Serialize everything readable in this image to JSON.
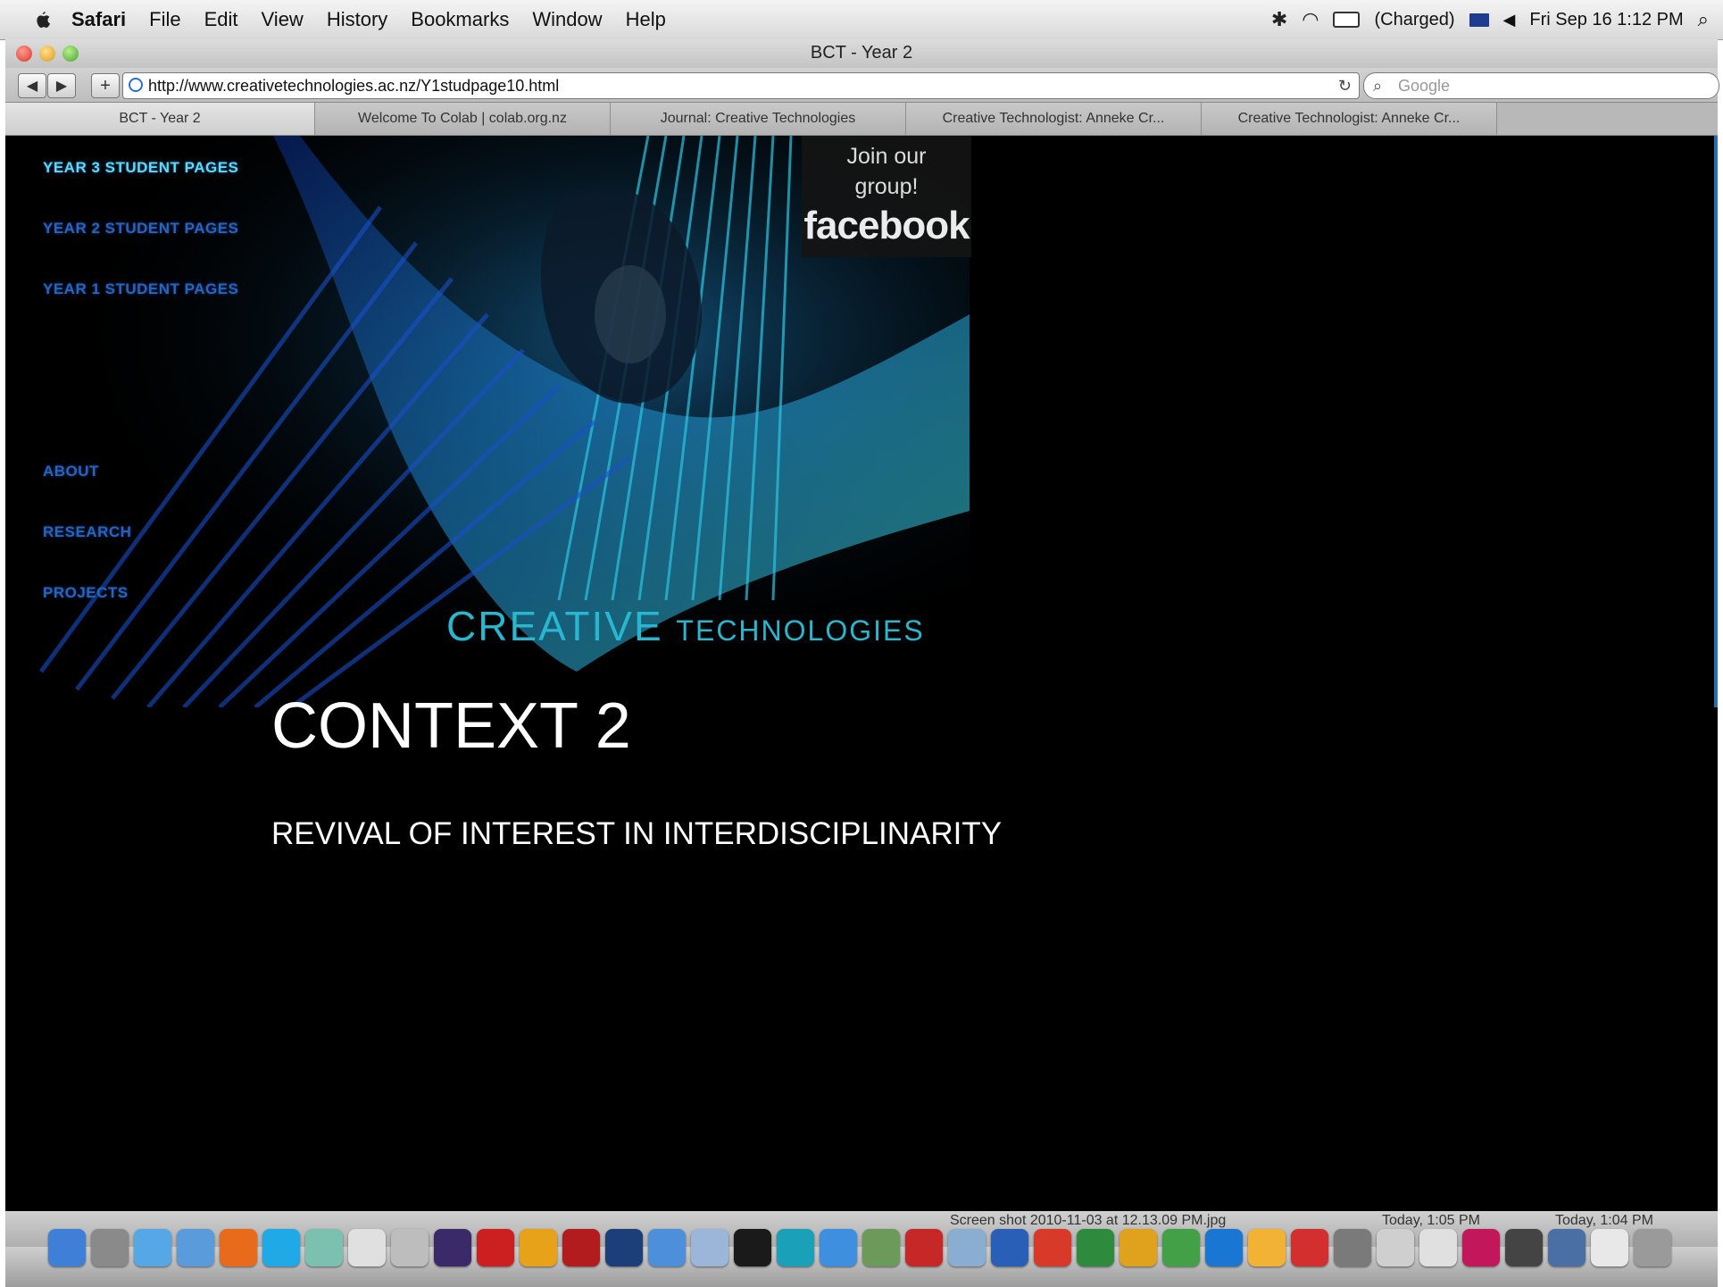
{
  "menubar": {
    "items": [
      "Safari",
      "File",
      "Edit",
      "View",
      "History",
      "Bookmarks",
      "Window",
      "Help"
    ],
    "battery_text": "(Charged)",
    "clock": "Fri Sep 16  1:12 PM",
    "icons": [
      "apple-icon",
      "bluetooth-icon",
      "wifi-icon",
      "battery-icon",
      "flag-icon",
      "volume-icon",
      "spotlight-icon"
    ]
  },
  "window": {
    "title": "BCT - Year 2"
  },
  "toolbar": {
    "back": "◀",
    "forward": "▶",
    "add": "+",
    "url": "http://www.creativetechnologies.ac.nz/Y1studpage10.html",
    "reload": "↻",
    "search_placeholder": "Google"
  },
  "tabs": [
    {
      "label": "BCT - Year 2",
      "active": true
    },
    {
      "label": "Welcome To Colab | colab.org.nz",
      "active": false
    },
    {
      "label": "Journal: Creative Technologies",
      "active": false
    },
    {
      "label": "Creative Technologist: Anneke Cr...",
      "active": false
    },
    {
      "label": "Creative Technologist: Anneke Cr...",
      "active": false
    }
  ],
  "page": {
    "nav": [
      "YEAR 3 STUDENT PAGES",
      "YEAR 2 STUDENT PAGES",
      "YEAR 1 STUDENT PAGES",
      "ABOUT",
      "RESEARCH",
      "PROJECTS"
    ],
    "facebook": {
      "join": "Join our group!",
      "logo": "facebook"
    },
    "brand": {
      "big": "CREATIVE ",
      "small": "TECHNOLOGIES"
    },
    "heading": "CONTEXT 2",
    "subheading": "REVIVAL OF INTEREST IN INTERDISCIPLINARITY"
  },
  "dock": {
    "labels": [
      "Screen shot 2010-11-03 at 12.13.09 PM.jpg",
      "Today, 1:05 PM",
      "Today, 1:04 PM"
    ],
    "icons": [
      "finder-icon",
      "utility-icon",
      "safari-icon",
      "compass-icon",
      "firefox-icon",
      "skype-icon",
      "maps-icon",
      "calendar-icon",
      "calculator-icon",
      "premiere-icon",
      "acrobat-icon",
      "illustrator-icon",
      "acrobat-pro-icon",
      "photoshop-icon",
      "itunes-icon",
      "preview-icon",
      "p-icon",
      "arduino-icon",
      "chat-icon",
      "photo-icon",
      "red-app-icon",
      "image-icon",
      "word-icon",
      "help-icon",
      "excel-icon",
      "outlook-icon",
      "messenger-icon",
      "c-icon",
      "puzzle-icon",
      "drop-icon",
      "folder-icon",
      "doc-icon",
      "calendar-2-icon",
      "indesign-icon",
      "clapper-icon",
      "globe-icon",
      "home-icon",
      "trash-icon"
    ],
    "colors": [
      "#3f7fd8",
      "#8a8a8a",
      "#55a7e6",
      "#5a9bdc",
      "#e86b1c",
      "#1fa9e6",
      "#7cc0b0",
      "#e0e0e0",
      "#bdbdbd",
      "#3a2a6a",
      "#cc1f1f",
      "#e8a21a",
      "#b31c1c",
      "#1c3f7a",
      "#4d8fdb",
      "#9bb6d9",
      "#1a1a1a",
      "#1aa0b8",
      "#3f8fe0",
      "#6b9a5a",
      "#c62828",
      "#8aaed1",
      "#2a5fb8",
      "#d83a2a",
      "#2e8b3d",
      "#e0a11c",
      "#43a047",
      "#1976d2",
      "#f2b233",
      "#d32f2f",
      "#7a7a7a",
      "#cfcfcf",
      "#e0e0e0",
      "#c2185b",
      "#444444",
      "#4a6fa5",
      "#e8e8e8",
      "#9a9a9a"
    ]
  }
}
